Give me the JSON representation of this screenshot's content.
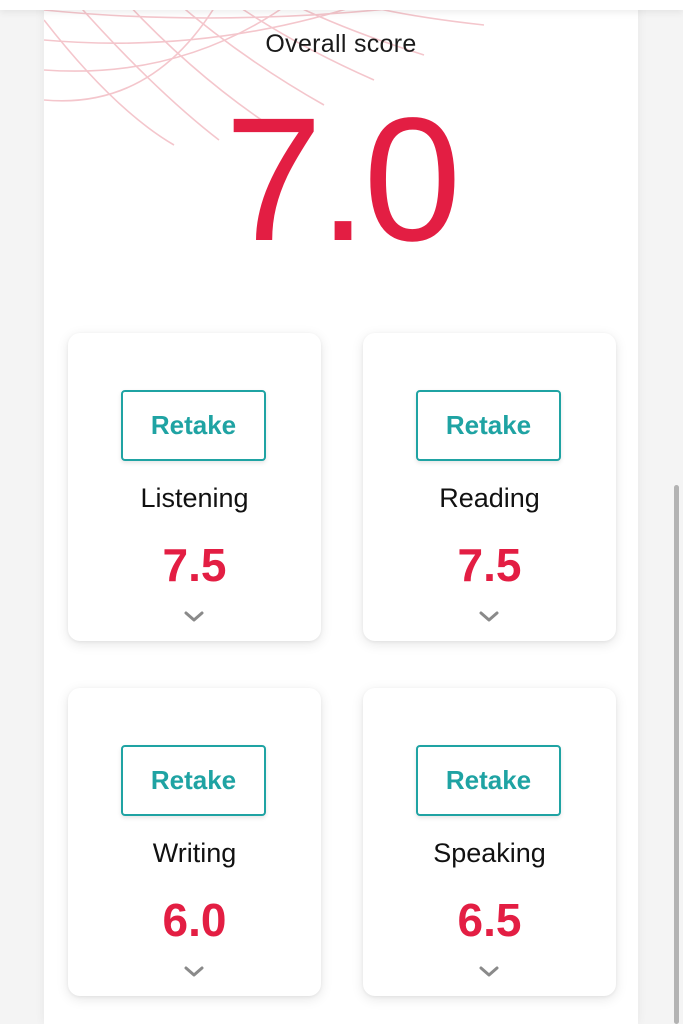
{
  "overall": {
    "label": "Overall score",
    "score": "7.0"
  },
  "sections": [
    {
      "retake_label": "Retake",
      "name": "Listening",
      "score": "7.5",
      "expand_icon": "chevron-down-icon"
    },
    {
      "retake_label": "Retake",
      "name": "Reading",
      "score": "7.5",
      "expand_icon": "chevron-down-icon"
    },
    {
      "retake_label": "Retake",
      "name": "Writing",
      "score": "6.0",
      "expand_icon": "chevron-down-icon"
    },
    {
      "retake_label": "Retake",
      "name": "Speaking",
      "score": "6.5",
      "expand_icon": "chevron-down-icon"
    }
  ],
  "colors": {
    "score_red": "#e31e43",
    "retake_teal": "#1fa3a3",
    "decor_grid": "#f4c6cc"
  }
}
